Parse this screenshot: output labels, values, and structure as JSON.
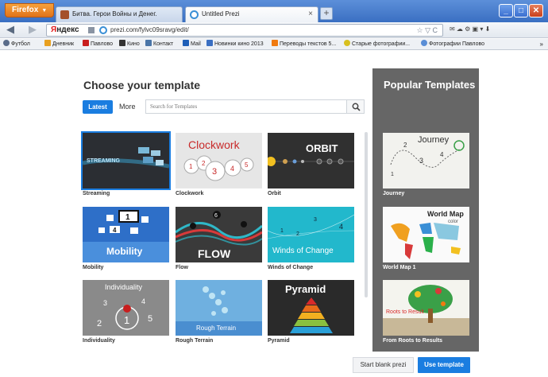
{
  "browser": {
    "menu_button": "Firefox",
    "tabs": [
      {
        "label": "Битва. Герои Войны и Денег.",
        "active": false
      },
      {
        "label": "Untitled Prezi",
        "active": true
      }
    ],
    "new_tab": "+",
    "search_engine": {
      "ya": "Я",
      "rest": "ндекс"
    },
    "url": "prezi.com/fylvc09sravg/edit/",
    "bookmarks": [
      "Футбол",
      "Дневник",
      "Павлово",
      "Кино",
      "Контакт",
      "Mail",
      "Новинки кино 2013",
      "Переводы текстов 5...",
      "Старые фотографии...",
      "Фотографии Павлово"
    ],
    "bookmarks_more": "»"
  },
  "page": {
    "title": "Choose your template",
    "filters": {
      "latest": "Latest",
      "more": "More"
    },
    "search_placeholder": "Search for Templates",
    "templates": [
      {
        "label": "Streaming",
        "thumb_text": "STREAMING",
        "selected": true
      },
      {
        "label": "Clockwork",
        "thumb_text": "Clockwork"
      },
      {
        "label": "Orbit",
        "thumb_text": "ORBIT"
      },
      {
        "label": "Mobility",
        "thumb_text": "Mobility"
      },
      {
        "label": "Flow",
        "thumb_text": "FLOW"
      },
      {
        "label": "Winds of Change",
        "thumb_text": "Winds of Change"
      },
      {
        "label": "Individuality",
        "thumb_text": "Individuality"
      },
      {
        "label": "Rough Terrain",
        "thumb_text": "Rough Terrain"
      },
      {
        "label": "Pyramid",
        "thumb_text": "Pyramid"
      }
    ],
    "popular": {
      "title": "Popular Templates",
      "items": [
        {
          "label": "Journey",
          "thumb_text": "Journey"
        },
        {
          "label": "World Map 1",
          "thumb_text": "World Map",
          "thumb_sub": "color"
        },
        {
          "label": "From Roots to Results",
          "thumb_text": "Roots to Result"
        }
      ]
    },
    "buttons": {
      "blank": "Start blank prezi",
      "use": "Use template"
    }
  },
  "colors": {
    "accent": "#1a7de0",
    "popular_panel": "#666666",
    "titlebar": "#3a6fc2"
  }
}
